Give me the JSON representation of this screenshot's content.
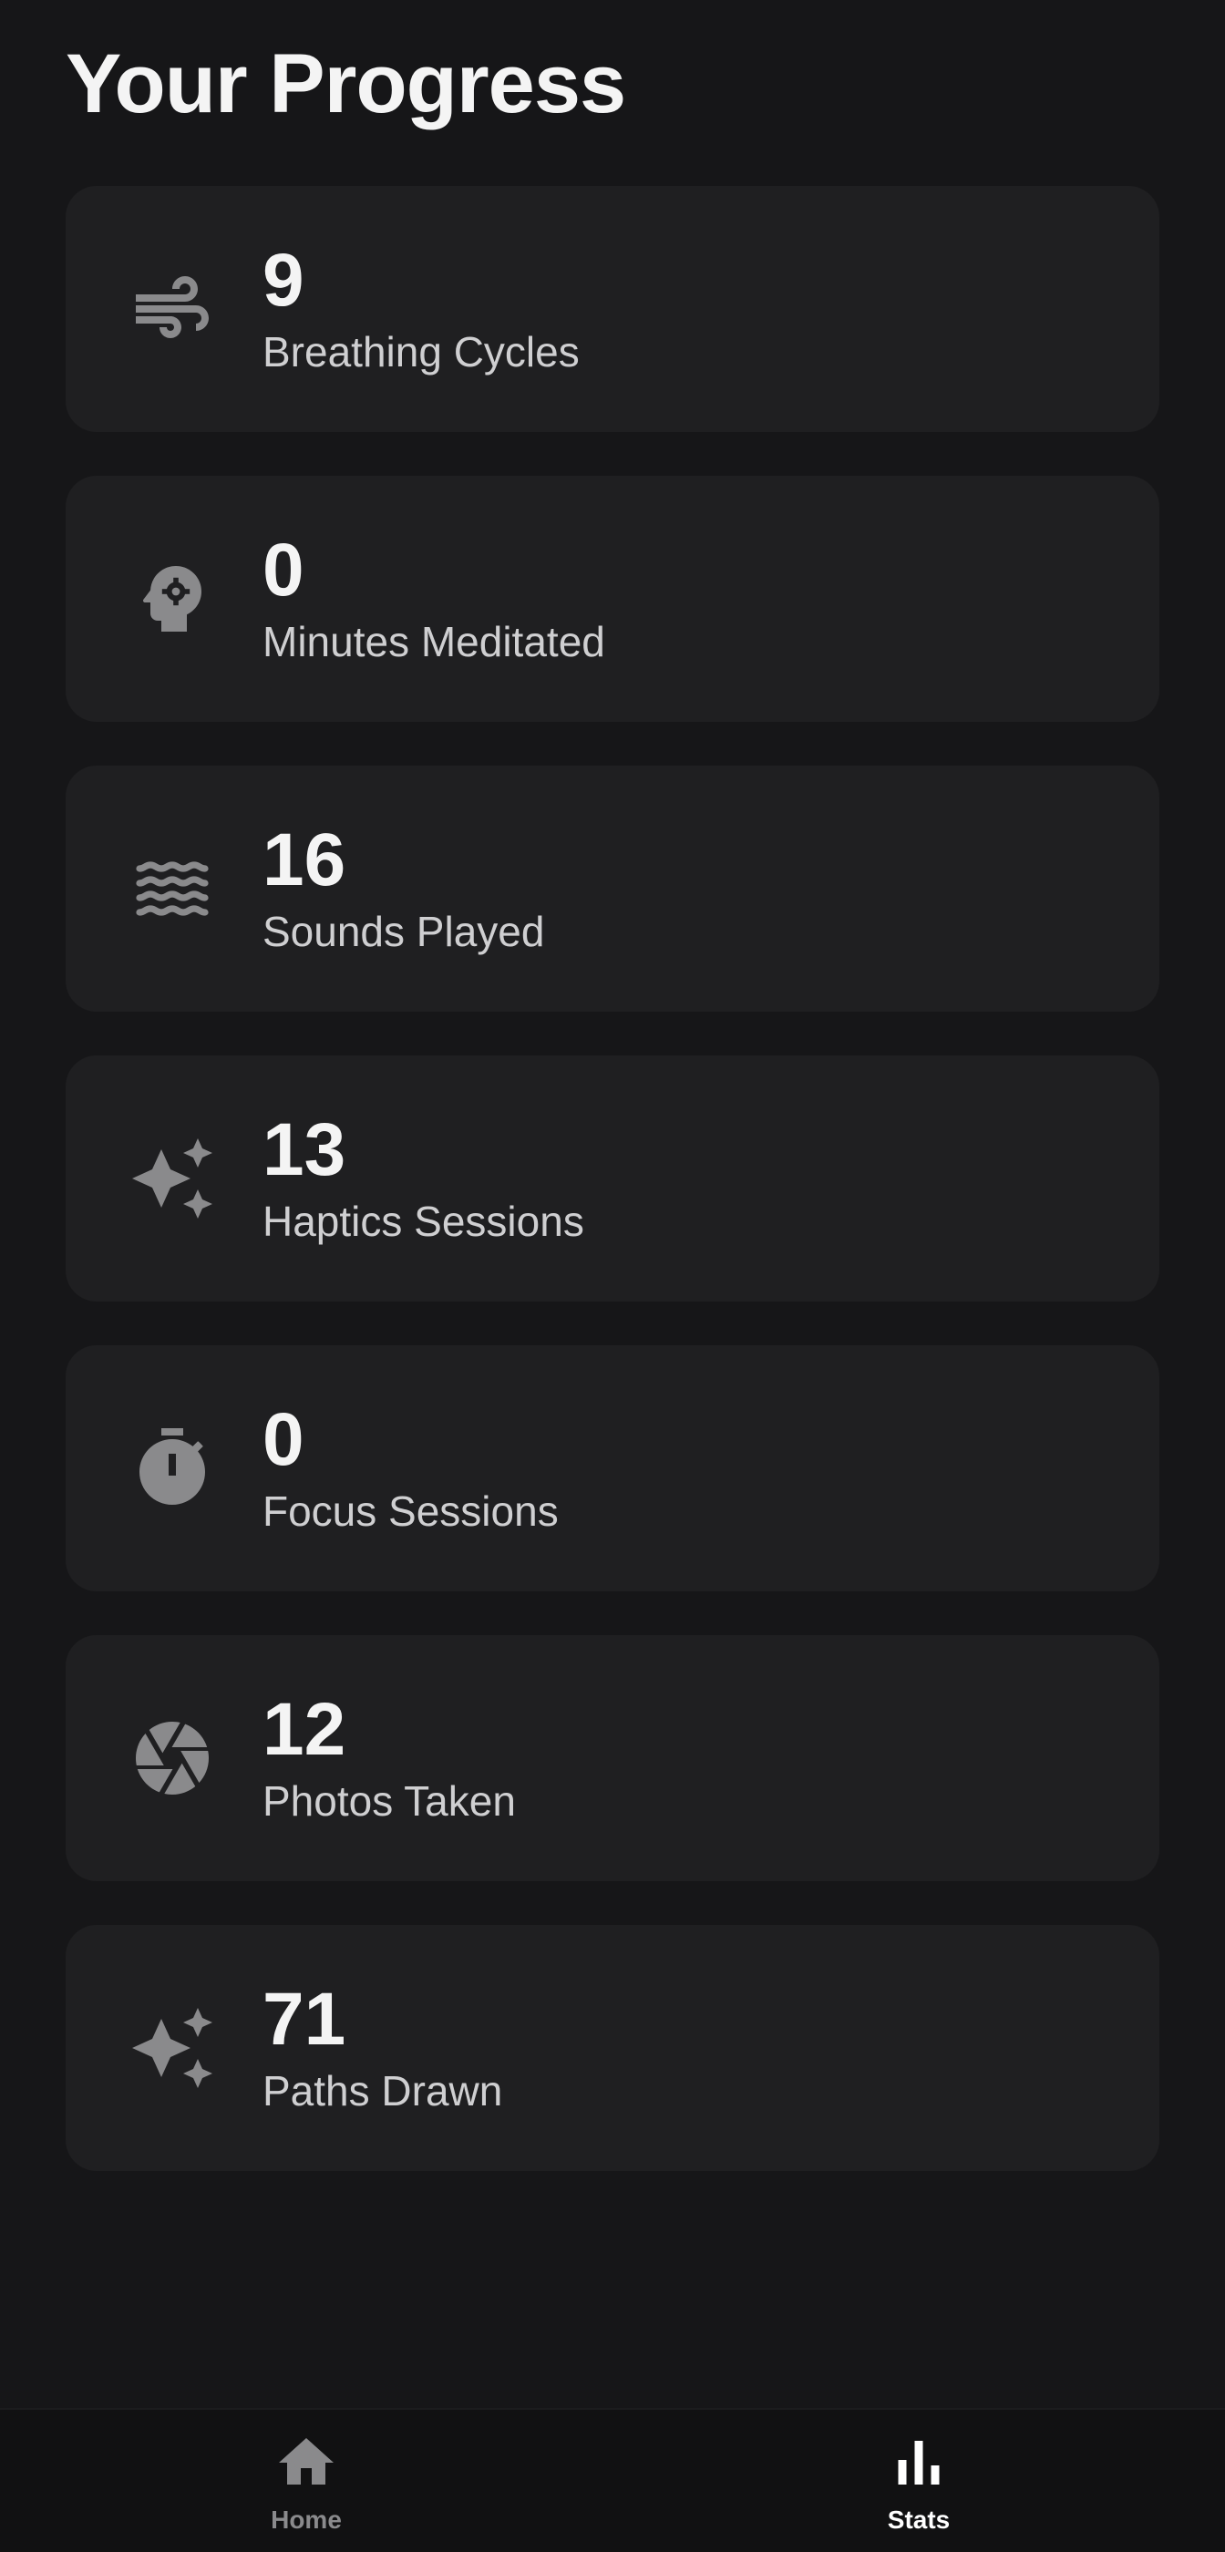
{
  "header": {
    "title": "Your Progress"
  },
  "stats": [
    {
      "value": "9",
      "label": "Breathing Cycles",
      "icon": "wind-icon"
    },
    {
      "value": "0",
      "label": "Minutes Meditated",
      "icon": "head-gear-icon"
    },
    {
      "value": "16",
      "label": "Sounds Played",
      "icon": "waves-icon"
    },
    {
      "value": "13",
      "label": "Haptics Sessions",
      "icon": "sparkles-icon"
    },
    {
      "value": "0",
      "label": "Focus Sessions",
      "icon": "timer-icon"
    },
    {
      "value": "12",
      "label": "Photos Taken",
      "icon": "aperture-icon"
    },
    {
      "value": "71",
      "label": "Paths Drawn",
      "icon": "sparkles-icon"
    }
  ],
  "nav": {
    "items": [
      {
        "label": "Home",
        "icon": "home-icon",
        "active": false
      },
      {
        "label": "Stats",
        "icon": "bar-chart-icon",
        "active": true
      }
    ]
  },
  "colors": {
    "background": "#161618",
    "card": "#1f1f21",
    "icon": "#8a8a8c",
    "text_primary": "#f4f4f4",
    "text_secondary": "#cfcfd1",
    "nav_background": "#111112",
    "nav_active": "#ffffff",
    "nav_inactive": "#8a8a8c"
  }
}
